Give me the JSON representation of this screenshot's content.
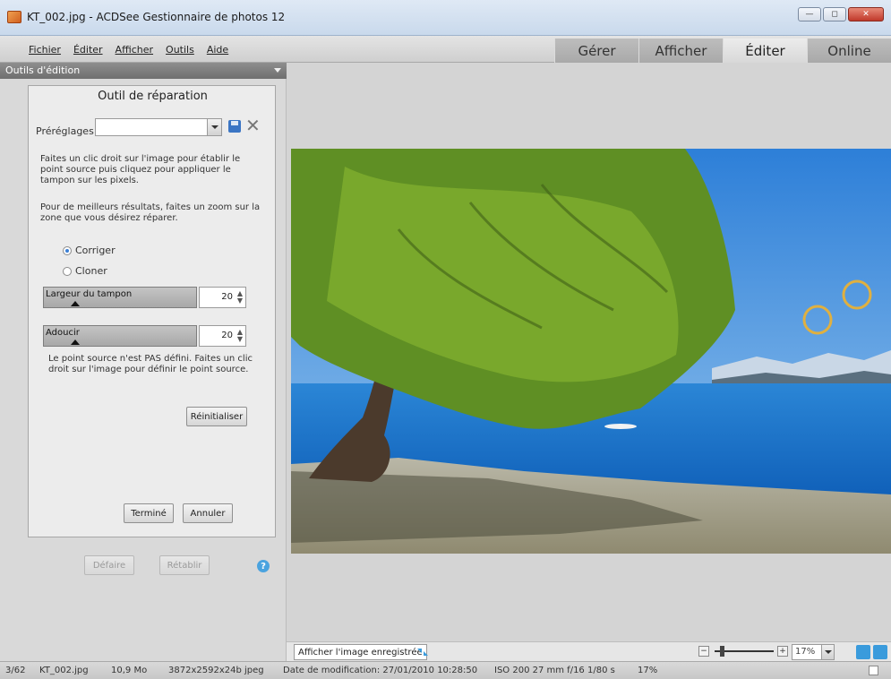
{
  "window": {
    "title": "KT_002.jpg - ACDSee Gestionnaire de photos 12",
    "controls": [
      "minimize",
      "maximize",
      "close"
    ]
  },
  "menu": [
    "Fichier",
    "Éditer",
    "Afficher",
    "Outils",
    "Aide"
  ],
  "modes": [
    {
      "label": "Gérer",
      "active": false
    },
    {
      "label": "Afficher",
      "active": false
    },
    {
      "label": "Éditer",
      "active": true
    },
    {
      "label": "Online",
      "active": false
    }
  ],
  "panel": {
    "header": "Outils d'édition",
    "tool_title": "Outil de réparation",
    "presets_label": "Préréglages",
    "presets_value": "",
    "help_text_1": "Faites un clic droit sur l'image pour établir le point source puis cliquez pour appliquer le tampon sur les pixels.",
    "help_text_2": "Pour de meilleurs résultats, faites un zoom sur la zone que vous désirez réparer.",
    "mode_options": [
      {
        "label": "Corriger",
        "selected": true
      },
      {
        "label": "Cloner",
        "selected": false
      }
    ],
    "brush_width": {
      "label": "Largeur du tampon",
      "value": "20"
    },
    "feather": {
      "label": "Adoucir",
      "value": "20"
    },
    "source_note": "Le point source n'est PAS défini. Faites un clic droit sur l'image pour définir le point source.",
    "reset_label": "Réinitialiser",
    "done_label": "Terminé",
    "cancel_label": "Annuler",
    "undo_label": "Défaire",
    "redo_label": "Rétablir",
    "help_icon": "?"
  },
  "viewer": {
    "show_saved_label": "Afficher l'image enregistrée",
    "zoom_value": "17%"
  },
  "status": {
    "index": "3/62",
    "filename": "KT_002.jpg",
    "filesize": "10,9 Mo",
    "dims": "3872x2592x24b jpeg",
    "modified": "Date de modification: 27/01/2010 10:28:50",
    "exif": "ISO 200  27 mm  f/16  1/80 s",
    "zoom": "17%"
  },
  "colors": {
    "accent": "#3b7fd4",
    "sky": "#3f8fe0",
    "lake": "#1f6fc8",
    "foliage": "#6e9a2a",
    "brush_ring": "#e0b040"
  }
}
